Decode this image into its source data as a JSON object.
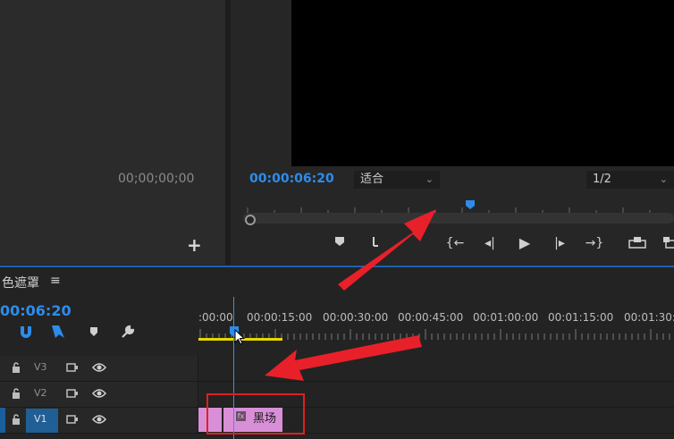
{
  "source_monitor": {
    "timecode": "00;00;00;00",
    "add_label": "+"
  },
  "program_monitor": {
    "timecode": "00:00:06:20",
    "fit_dropdown": "适合",
    "resolution_dropdown": "1/2",
    "transport": {
      "mark_in": "▾",
      "go_to_in": "{←",
      "step_back": "◂|",
      "play": "▶",
      "step_forward": "|▸",
      "go_to_out": "→}"
    }
  },
  "timeline": {
    "tab_title": "色遮罩",
    "menu_icon": "≡",
    "timecode": "00:06:20",
    "ruler_labels": [
      ":00:00",
      "00:00:15:00",
      "00:00:30:00",
      "00:00:45:00",
      "00:01:00:00",
      "00:01:15:00",
      "00:01:30:0"
    ],
    "tracks": [
      {
        "name": "V3"
      },
      {
        "name": "V2"
      },
      {
        "name": "V1"
      }
    ],
    "clip": {
      "fx": "fx",
      "label": "黑场"
    }
  },
  "colors": {
    "accent": "#2d8ceb",
    "clip": "#d98fd7",
    "annotation": "#e02020",
    "work_area": "#e6d800"
  }
}
